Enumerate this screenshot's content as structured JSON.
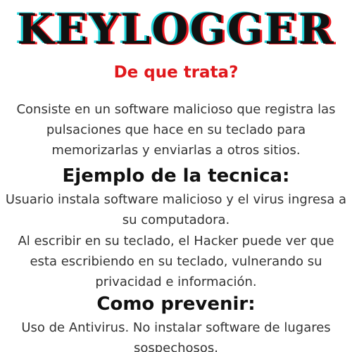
{
  "poster": {
    "title": "KEYLOGGER",
    "subtitle": "De que trata?",
    "intro": "Consiste en un software malicioso que registra las pulsaciones que hace en su teclado para memorizarlas y enviarlas a otros sitios.",
    "example_heading": "Ejemplo de la tecnica:",
    "example_text_1": "Usuario instala software malicioso y el virus ingresa a su computadora.",
    "example_text_2": "Al escribir en su teclado, el Hacker puede ver que esta escribiendo en su teclado, vulnerando su privacidad e información.",
    "prevent_heading": "Como prevenir:",
    "prevent_text": "Uso de Antivirus. No instalar software de lugares sospechosos."
  },
  "colors": {
    "title_text": "#111111",
    "title_shadow_cyan": "#22d6dc",
    "title_shadow_red": "#ef1a22",
    "subtitle": "#e0181c",
    "body_text": "#333333",
    "background": "#ffffff"
  }
}
